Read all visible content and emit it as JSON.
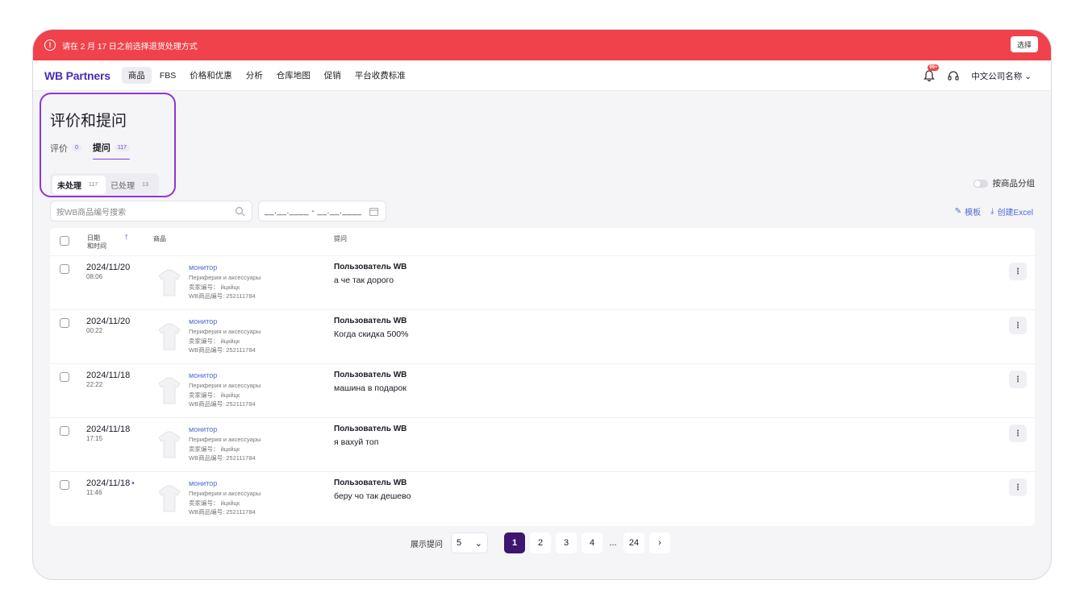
{
  "alert": {
    "message": "请在 2 月 17 日之前选择退货处理方式",
    "button": "选择"
  },
  "nav": {
    "logo": "WB Partners",
    "items": [
      "商品",
      "FBS",
      "价格和优惠",
      "分析",
      "仓库地图",
      "促销",
      "平台收费标准"
    ],
    "notification_badge": "99+",
    "company": "中文公司名称"
  },
  "page": {
    "title": "评价和提问",
    "tabs": [
      {
        "label": "评价",
        "count": "0"
      },
      {
        "label": "提问",
        "count": "117"
      }
    ],
    "subtabs": [
      {
        "label": "未处理",
        "count": "117"
      },
      {
        "label": "已处理",
        "count": "13"
      }
    ],
    "group_toggle": "按商品分组",
    "search_placeholder": "按WB商品编号搜索",
    "date_placeholder": "__.__.____ - __.__.____",
    "template": "模板",
    "excel": "创建Excel"
  },
  "table": {
    "headers": {
      "date_line1": "日期",
      "date_line2": "和时间",
      "product": "商品",
      "question": "提问"
    },
    "rows": [
      {
        "date": "2024/11/20",
        "time": "08:06",
        "dot": "",
        "product": "монитор",
        "category": "Периферия и аксессуары",
        "seller": "卖家编号： йцкйцк",
        "wb": "WB商品编号: 252111784",
        "user": "Пользователь WB",
        "question": "а че так дорого"
      },
      {
        "date": "2024/11/20",
        "time": "00:22",
        "dot": "",
        "product": "монитор",
        "category": "Периферия и аксессуары",
        "seller": "卖家编号： йцкйцк",
        "wb": "WB商品编号: 252111784",
        "user": "Пользователь WB",
        "question": "Когда скидка 500%"
      },
      {
        "date": "2024/11/18",
        "time": "22:22",
        "dot": "",
        "product": "монитор",
        "category": "Периферия и аксессуары",
        "seller": "卖家编号： йцкйцк",
        "wb": "WB商品编号: 252111784",
        "user": "Пользователь WB",
        "question": "машина в подарок"
      },
      {
        "date": "2024/11/18",
        "time": "17:15",
        "dot": "",
        "product": "монитор",
        "category": "Периферия и аксессуары",
        "seller": "卖家编号： йцкйцк",
        "wb": "WB商品编号: 252111784",
        "user": "Пользователь WB",
        "question": "я вахуй топ"
      },
      {
        "date": "2024/11/18",
        "time": "11:46",
        "dot": "•",
        "product": "монитор",
        "category": "Периферия и аксессуары",
        "seller": "卖家编号： йцкйцк",
        "wb": "WB商品编号: 252111784",
        "user": "Пользователь WB",
        "question": "беру чо так дешево"
      }
    ]
  },
  "pagination": {
    "label": "展示提问",
    "per_page": "5",
    "pages": [
      "1",
      "2",
      "3",
      "4",
      "...",
      "24"
    ],
    "current": "1",
    "next": "›"
  },
  "colors": {
    "alert": "#f0424b",
    "brand": "#4e2bb5",
    "accent": "#7b3fe4",
    "current_page": "#3d1670",
    "link": "#4e6bd6"
  }
}
